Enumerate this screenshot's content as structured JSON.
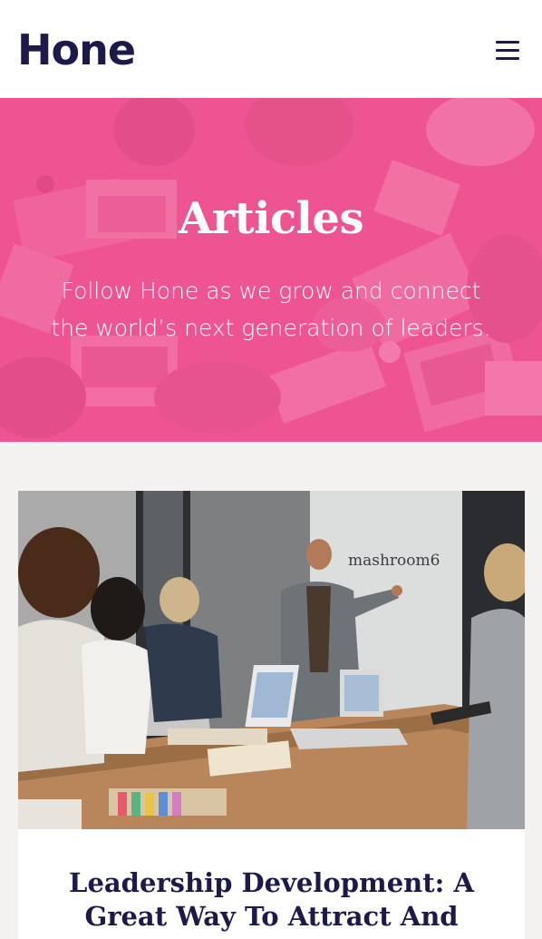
{
  "header": {
    "logo_text": "Hone",
    "menu_icon": "hamburger-menu-icon"
  },
  "hero": {
    "title": "Articles",
    "subtitle": "Follow Hone as we grow and connect the world’s next generation of leaders.",
    "overlay_color": "#ec5f96"
  },
  "articles": [
    {
      "image_caption_sign": "mashroom6",
      "title": "Leadership Development: A Great Way To Attract And"
    }
  ],
  "colors": {
    "brand_navy": "#1c1a4a",
    "hero_pink": "#ec5f96",
    "page_bg": "#f3f2f0"
  }
}
